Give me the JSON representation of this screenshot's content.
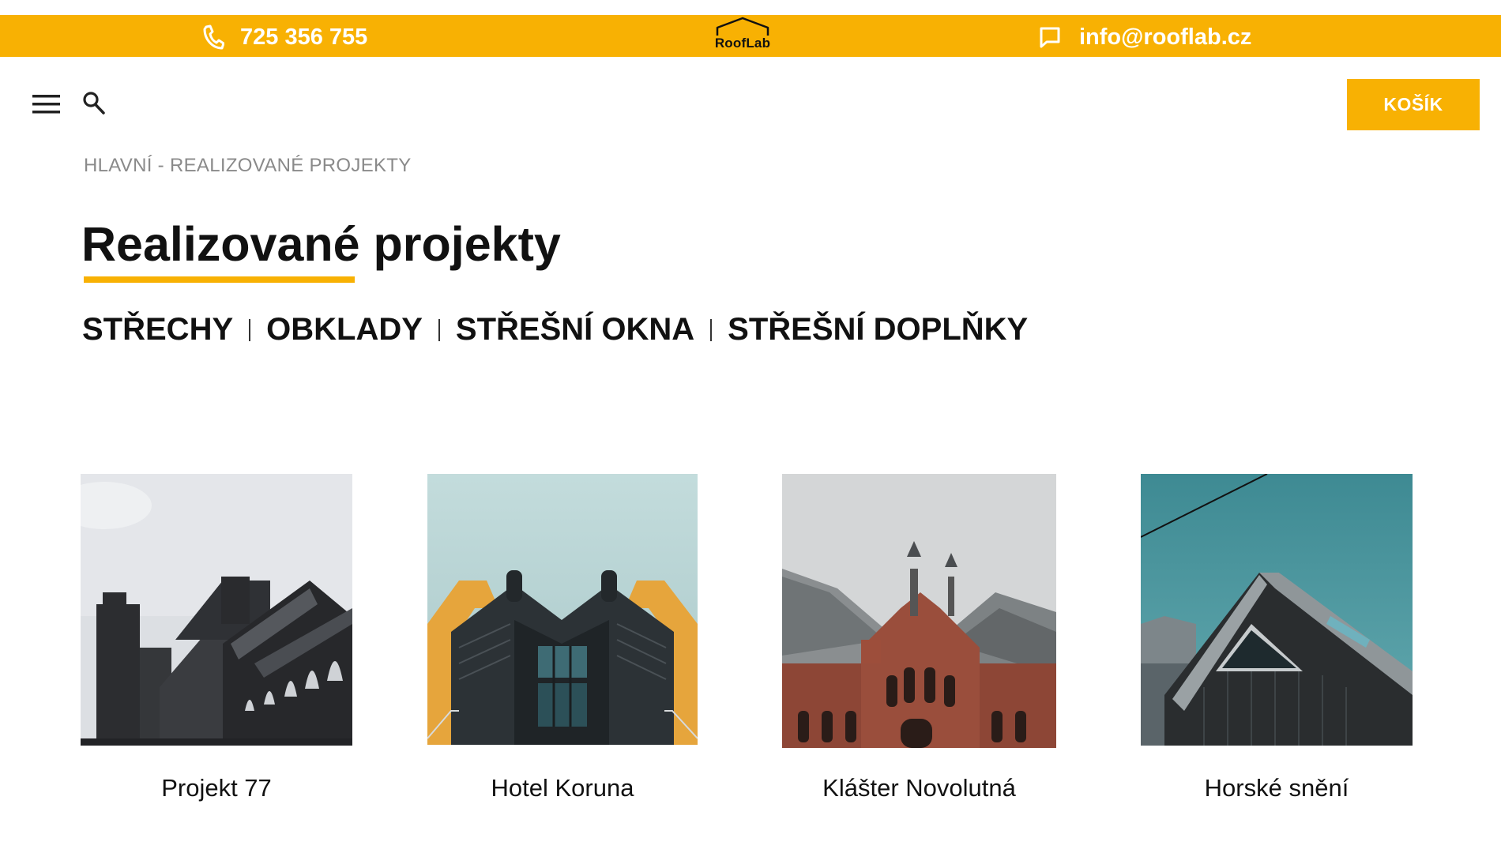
{
  "topbar": {
    "phone": "725 356 755",
    "email": "info@rooflab.cz",
    "logo_text": "RoofLab",
    "phone_icon": "phone-icon",
    "email_icon": "chat-icon"
  },
  "nav": {
    "menu_icon": "hamburger-menu-icon",
    "search_icon": "search-icon",
    "cart_label": "KOŠÍK"
  },
  "breadcrumb": {
    "home": "HLAVNÍ",
    "separator": " - ",
    "current": "REALIZOVANÉ PROJEKTY"
  },
  "page_title": "Realizované projekty",
  "filters": [
    "STŘECHY",
    "OBKLADY",
    "STŘEŠNÍ OKNA",
    "STŘEŠNÍ DOPLŇKY"
  ],
  "projects": [
    {
      "title": "Projekt 77"
    },
    {
      "title": "Hotel Koruna"
    },
    {
      "title": "Klášter Novolutná"
    },
    {
      "title": "Horské snění"
    }
  ],
  "colors": {
    "accent": "#F8B103",
    "text": "#111111",
    "muted": "#8a8a8a"
  }
}
